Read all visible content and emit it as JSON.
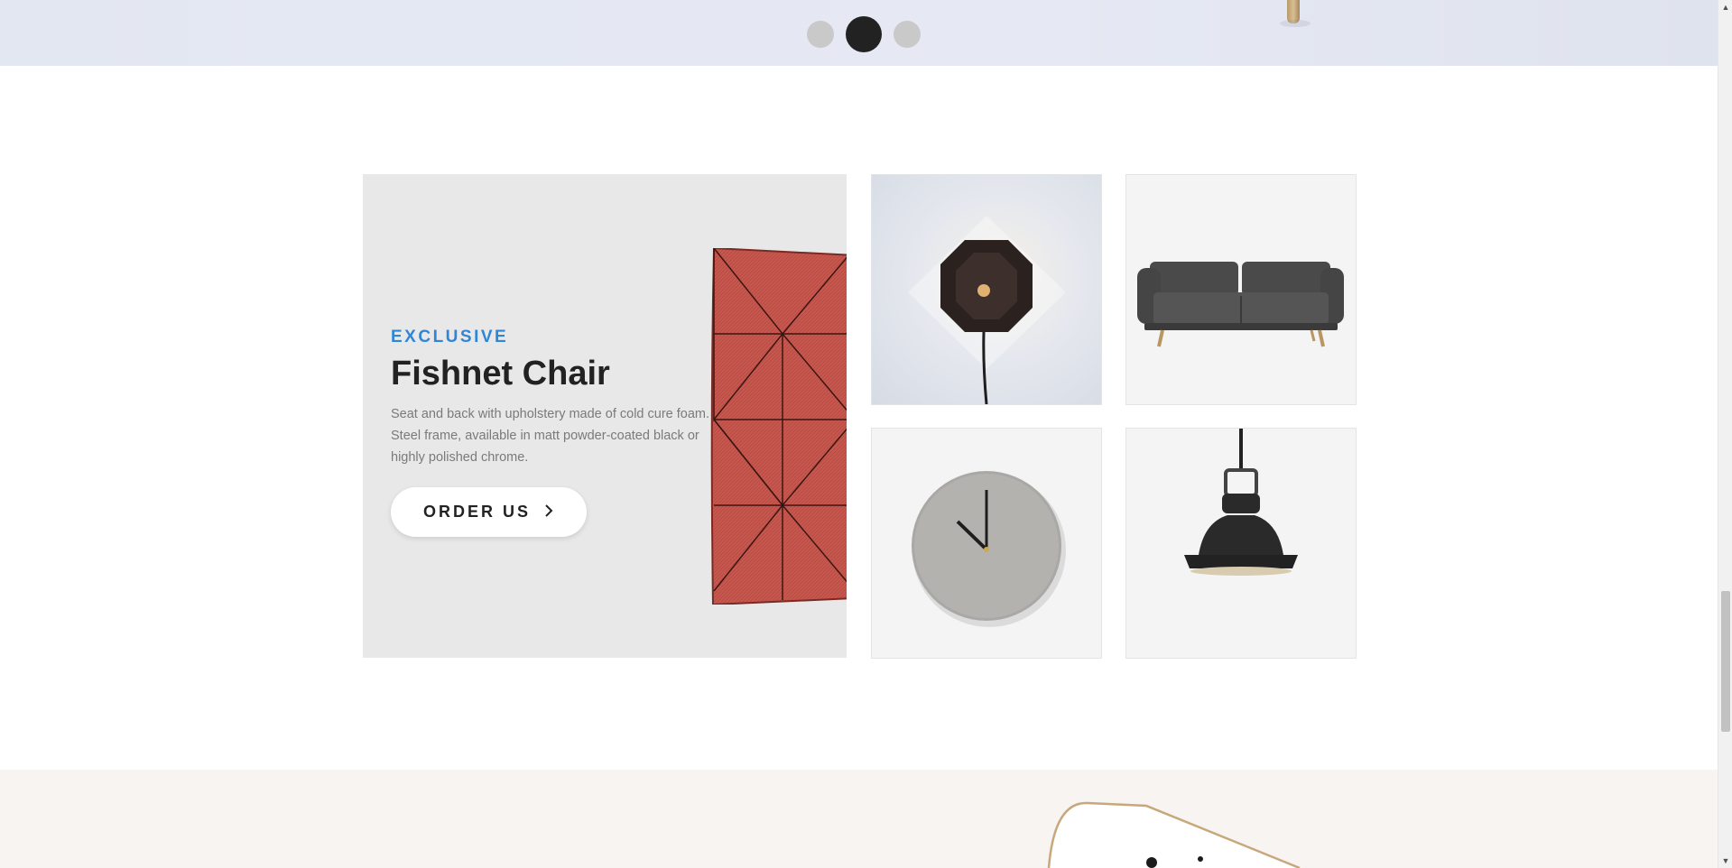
{
  "slider": {
    "dots": [
      {
        "label": "Slide 1",
        "active": false
      },
      {
        "label": "Slide 2",
        "active": true
      },
      {
        "label": "Slide 3",
        "active": false
      }
    ]
  },
  "banner": {
    "label": "EXCLUSIVE",
    "title": "Fishnet Chair",
    "description": "Seat and back with upholstery made of cold cure foam. Steel frame, available in matt powder-coated black or highly polished chrome.",
    "button_label": "ORDER US",
    "button_icon": "chevron-right-icon"
  },
  "products": [
    {
      "name": "wall-lamp",
      "icon": "wall-lamp-image"
    },
    {
      "name": "sofa",
      "icon": "sofa-image"
    },
    {
      "name": "wall-clock",
      "icon": "clock-image"
    },
    {
      "name": "pendant-lamp",
      "icon": "pendant-lamp-image"
    }
  ],
  "colors": {
    "accent": "#2f86d6",
    "text_dark": "#222222",
    "banner_bg": "#e8e8e8",
    "bottom_bg": "#f7f4f2"
  },
  "scrollbar": {
    "up": "▲",
    "down": "▼"
  }
}
